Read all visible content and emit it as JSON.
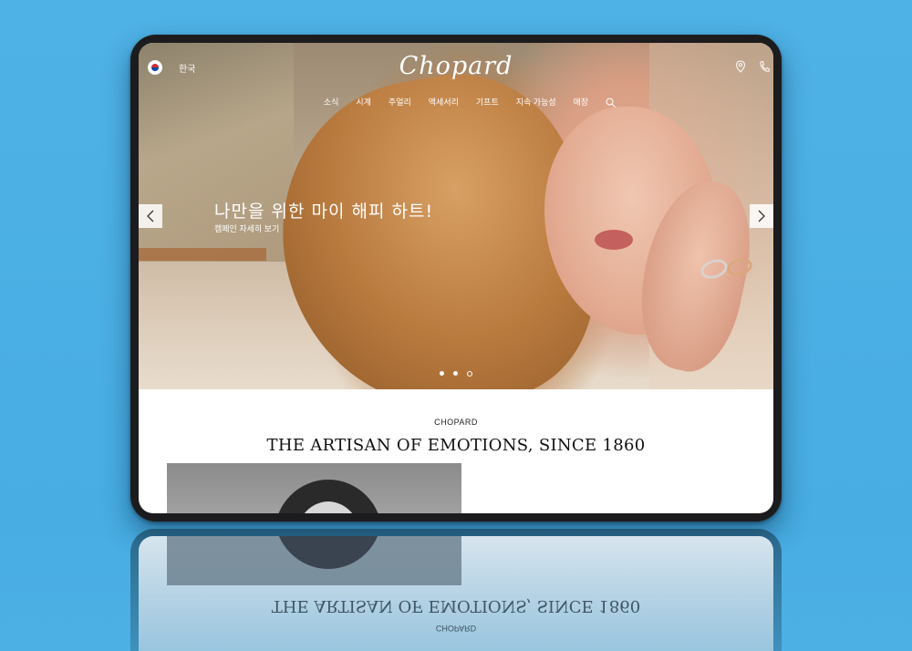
{
  "header": {
    "language_label": "한국",
    "logo_text": "Chopard",
    "nav_items": [
      "소식",
      "시계",
      "주얼리",
      "액세서리",
      "기프트",
      "지속 가능성",
      "매장"
    ],
    "icons": [
      "flag-korea-icon",
      "location-pin-icon",
      "phone-icon",
      "search-icon"
    ]
  },
  "hero": {
    "headline": "나만을 위한 마이 해피 하트!",
    "cta_link": "캠페인 자세히 보기",
    "slides": 3,
    "active_slide": 1
  },
  "section": {
    "brand_label": "CHOPARD",
    "tagline": "THE ARTISAN OF EMOTIONS, SINCE 1860"
  },
  "colors": {
    "background": "#49aee4",
    "device_frame": "#1c1c1e"
  }
}
